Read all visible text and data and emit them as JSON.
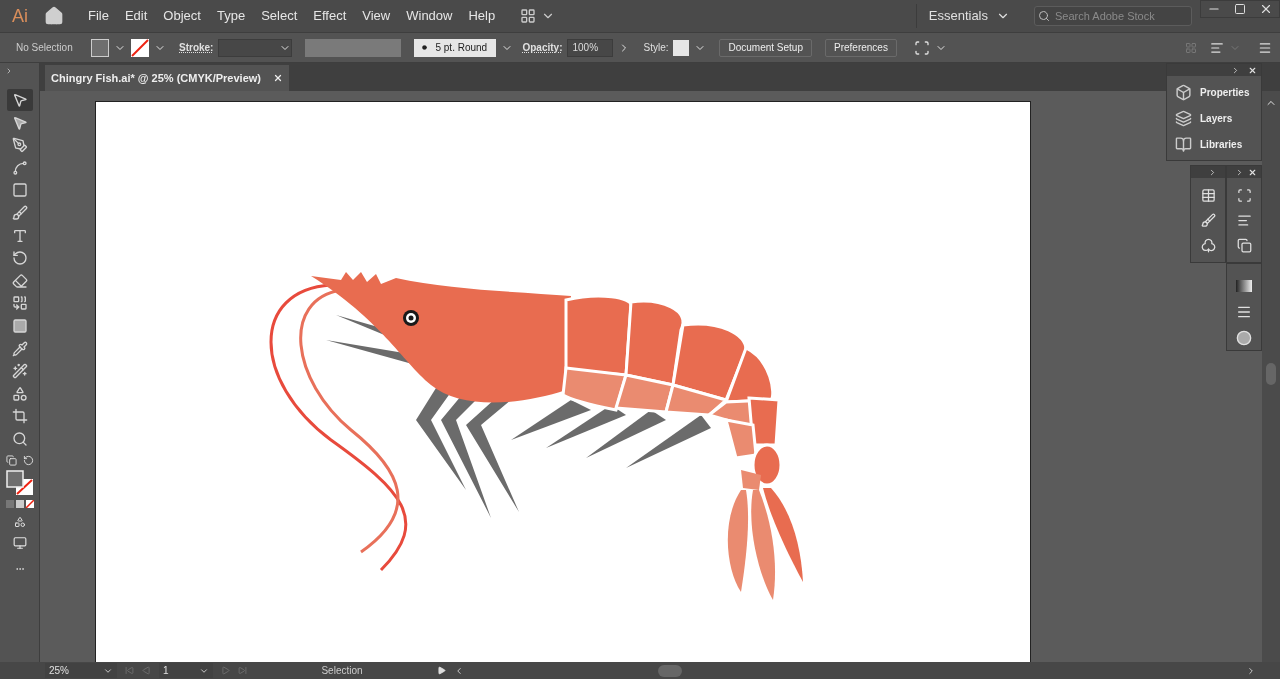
{
  "app_logo": "Ai",
  "menu": [
    "File",
    "Edit",
    "Object",
    "Type",
    "Select",
    "Effect",
    "View",
    "Window",
    "Help"
  ],
  "workspace": "Essentials",
  "search": {
    "placeholder": "Search Adobe Stock"
  },
  "control_bar": {
    "selection": "No Selection",
    "stroke_label": "Stroke:",
    "brush": "5 pt. Round",
    "opacity_label": "Opacity:",
    "opacity": "100%",
    "style_label": "Style:",
    "buttons": [
      "Document Setup",
      "Preferences"
    ]
  },
  "document_tab": {
    "title": "Chingry Fish.ai* @ 25% (CMYK/Preview)"
  },
  "tools": [
    {
      "kind": "selection",
      "selected": true
    },
    {
      "kind": "direct-selection",
      "selected": false
    },
    {
      "kind": "pen",
      "selected": false
    },
    {
      "kind": "curvature",
      "selected": false
    },
    {
      "kind": "rectangle",
      "selected": false
    },
    {
      "kind": "paintbrush",
      "selected": false
    },
    {
      "kind": "type",
      "selected": false
    },
    {
      "kind": "rotate",
      "selected": false
    },
    {
      "kind": "eraser",
      "selected": false
    },
    {
      "kind": "shape-builder",
      "selected": false
    },
    {
      "kind": "gradient",
      "selected": false
    },
    {
      "kind": "eyedropper",
      "selected": false
    },
    {
      "kind": "warp",
      "selected": false
    },
    {
      "kind": "symbol",
      "selected": false
    },
    {
      "kind": "artboard",
      "selected": false
    },
    {
      "kind": "zoom",
      "selected": false
    }
  ],
  "panels": [
    {
      "kind": "properties",
      "label": "Properties"
    },
    {
      "kind": "layers",
      "label": "Layers"
    },
    {
      "kind": "libraries",
      "label": "Libraries"
    }
  ],
  "status_bar": {
    "zoom": "25%",
    "artboard": "1",
    "tool": "Selection"
  }
}
